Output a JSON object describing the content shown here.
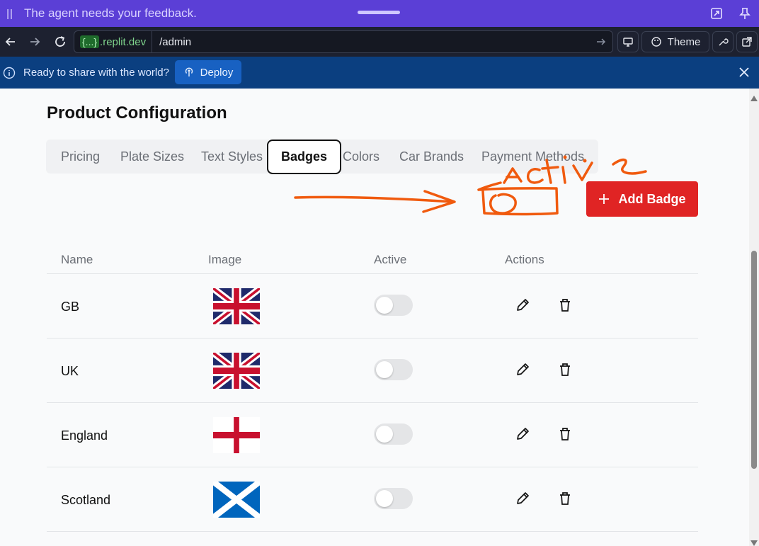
{
  "agent_banner": {
    "message": "The agent needs your feedback."
  },
  "browser": {
    "host_brace": "{...}",
    "host_rest": ".replit.dev",
    "path": "/admin",
    "theme_label": "Theme"
  },
  "deploy_banner": {
    "message": "Ready to share with the world?",
    "deploy_label": "Deploy"
  },
  "page": {
    "title": "Product Configuration",
    "tabs": [
      {
        "label": "Pricing"
      },
      {
        "label": "Plate Sizes"
      },
      {
        "label": "Text Styles"
      },
      {
        "label": "Badges"
      },
      {
        "label": "Colors"
      },
      {
        "label": "Car Brands"
      },
      {
        "label": "Payment Methods"
      }
    ],
    "active_tab": "Badges",
    "add_button": {
      "icon": "plus-icon",
      "label": "Add Badge"
    },
    "table": {
      "columns": [
        "Name",
        "Image",
        "Active",
        "Actions"
      ],
      "rows": [
        {
          "name": "GB",
          "flag": "union-jack",
          "active": false
        },
        {
          "name": "UK",
          "flag": "union-jack",
          "active": false
        },
        {
          "name": "England",
          "flag": "st-george-cross",
          "active": false
        },
        {
          "name": "Scotland",
          "flag": "saltire",
          "active": false
        }
      ]
    }
  },
  "annotation": {
    "text": "Active",
    "color": "#f05a0e"
  },
  "colors": {
    "agent_bar": "#5b3fd6",
    "browser_bar": "#1d2130",
    "deploy_bar": "#0b3f80",
    "accent_red": "#e02424"
  }
}
